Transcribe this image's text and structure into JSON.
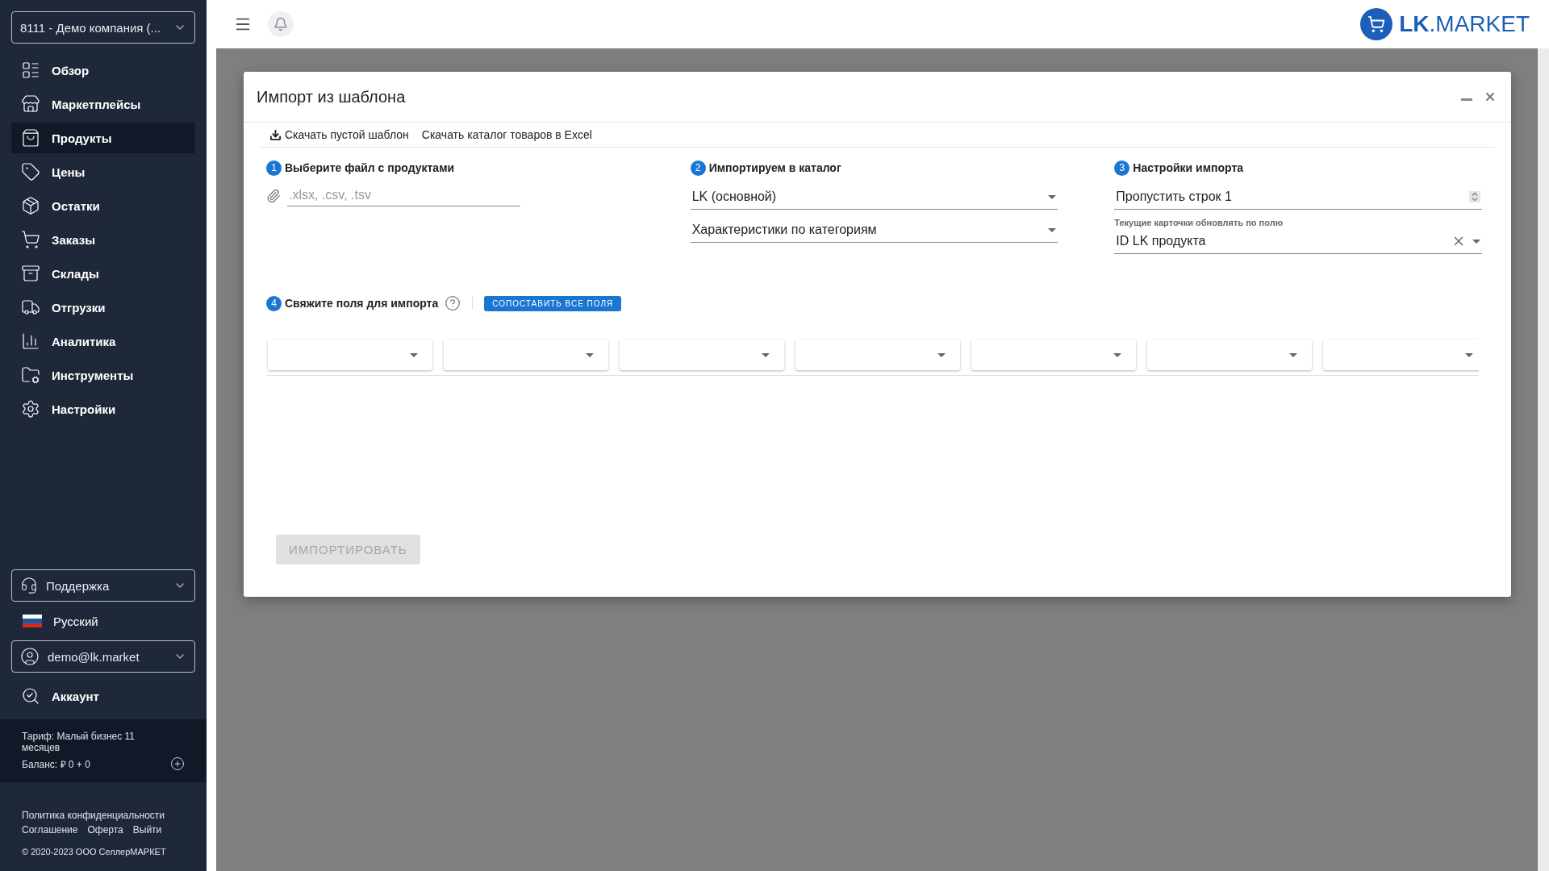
{
  "sidebar": {
    "company_select": "8111 - Демо компания (...",
    "nav_items": [
      {
        "label": "Обзор",
        "selected": false
      },
      {
        "label": "Маркетплейсы",
        "selected": false
      },
      {
        "label": "Продукты",
        "selected": true
      },
      {
        "label": "Цены",
        "selected": false
      },
      {
        "label": "Остатки",
        "selected": false
      },
      {
        "label": "Заказы",
        "selected": false
      },
      {
        "label": "Склады",
        "selected": false
      },
      {
        "label": "Отгрузки",
        "selected": false
      },
      {
        "label": "Аналитика",
        "selected": false
      },
      {
        "label": "Инструменты",
        "selected": false
      },
      {
        "label": "Настройки",
        "selected": false
      }
    ],
    "support_select": "Поддержка",
    "language": "Русский",
    "user_select": "demo@lk.market",
    "account_link": "Аккаунт",
    "tariff": {
      "plan": "Тариф: Малый бизнес 11 месяцев",
      "balance": "Баланс: ₽ 0 + 0"
    },
    "footer_links": [
      "Политика конфиденциальности",
      "Соглашение",
      "Оферта",
      "Выйти"
    ],
    "copyright": "© 2020-2023 ООО СеллерМАРКЕТ"
  },
  "header": {
    "logo": "**LK**.MARKET"
  },
  "modal": {
    "title": "Импорт из шаблона",
    "links": [
      {
        "label": "Скачать пустой шаблон",
        "kind": "download"
      },
      {
        "label": "Скачать каталог товаров в Excel",
        "kind": "plain"
      }
    ],
    "steps": [
      {
        "number": "1",
        "title": "Выберите файл с продуктами",
        "fields": [
          {
            "kind": "file",
            "placeholder": ".xlsx, .csv, .tsv"
          }
        ]
      },
      {
        "number": "2",
        "title": "Импортируем в каталог",
        "fields": [
          {
            "kind": "select",
            "value": "LK (основной)"
          },
          {
            "kind": "select",
            "value": "Характеристики по категориям"
          }
        ]
      },
      {
        "number": "3",
        "title": "Настройки импорта",
        "fields": [
          {
            "kind": "number",
            "value": "Пропустить строк 1"
          },
          {
            "kind": "clearable",
            "label": "Текущие карточки обновлять по полю",
            "value": "ID LK продукта"
          }
        ]
      }
    ],
    "mapping": {
      "number": "4",
      "title": "Свяжите поля для импорта",
      "match_button": "СОПОСТАВИТЬ ВСЕ ПОЛЯ",
      "selects": [
        {
          "kind": "dropdown"
        },
        {
          "kind": "dropdown"
        },
        {
          "kind": "dropdown"
        },
        {
          "kind": "dropdown"
        },
        {
          "kind": "dropdown"
        },
        {
          "kind": "dropdown"
        },
        {
          "kind": "dropdown"
        }
      ]
    },
    "import_button": {
      "label": "ИМПОРТИРОВАТЬ",
      "disabled": true
    }
  }
}
